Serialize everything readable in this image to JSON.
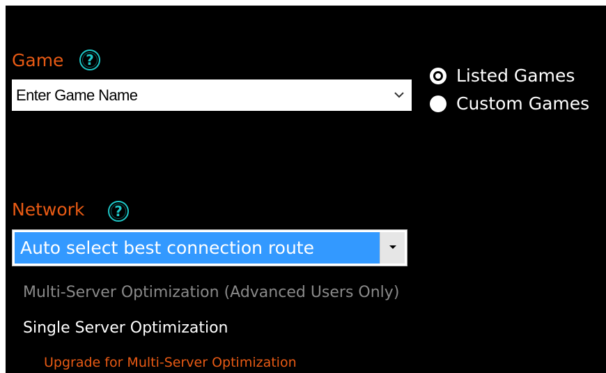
{
  "colors": {
    "background": "#000000",
    "section_label": "#e85a14",
    "help_icon": "#1ec8c8",
    "text_primary": "#ffffff",
    "text_disabled": "#8a8a8a",
    "selection": "#3399ff",
    "upgrade_link": "#e85a14"
  },
  "game": {
    "label": "Game",
    "help_icon": "?",
    "placeholder": "Enter Game Name"
  },
  "game_type": {
    "options": [
      {
        "label": "Listed Games",
        "selected": true
      },
      {
        "label": "Custom Games",
        "selected": false
      }
    ]
  },
  "network": {
    "label": "Network",
    "help_icon": "?",
    "selected_route": "Auto select best connection route"
  },
  "optimization": {
    "multi_server_label": "Multi-Server Optimization (Advanced Users Only)",
    "single_server_label": "Single Server Optimization",
    "upgrade_link": "Upgrade for Multi-Server Optimization"
  }
}
